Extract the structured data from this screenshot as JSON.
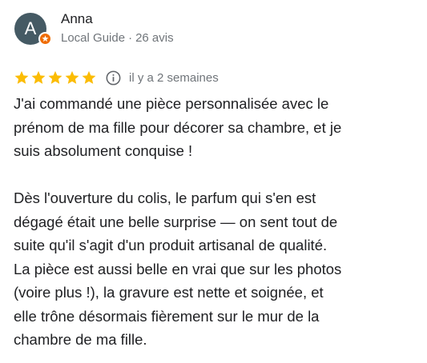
{
  "review": {
    "author": {
      "initial": "A",
      "name": "Anna",
      "role": "Local Guide",
      "separator": "·",
      "review_count": "26 avis"
    },
    "rating": {
      "stars": 5,
      "max": 5,
      "color": "#fbbc04"
    },
    "date": "il y a 2 semaines",
    "icons": {
      "badge": "local-guide-badge-icon",
      "info": "info-icon",
      "star": "star-icon"
    },
    "colors": {
      "avatar": "#455a64",
      "badge": "#ef6c00"
    },
    "paragraphs": [
      [
        "J'ai commandé une pièce  personnalisée avec le",
        "prénom de ma fille pour décorer sa chambre, et je",
        "suis absolument conquise !"
      ],
      [
        "Dès l'ouverture du colis, le parfum qui s'en est",
        "dégagé était une belle surprise — on sent tout de",
        "suite qu'il s'agit d'un produit artisanal de qualité.",
        "La pièce est aussi belle en vrai que sur les photos",
        "(voire plus !), la gravure est nette et soignée, et",
        "elle trône désormais fièrement sur le mur de la",
        "chambre de ma fille."
      ]
    ]
  }
}
